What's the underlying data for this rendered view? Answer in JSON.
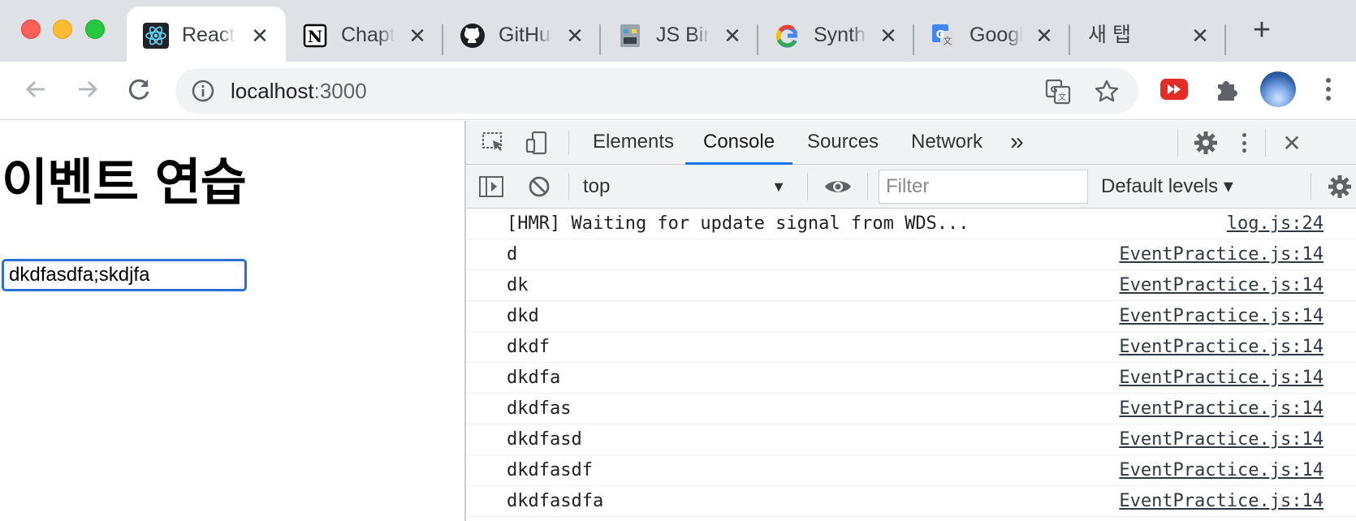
{
  "browser": {
    "tabs": [
      {
        "title": "React App",
        "icon": "react-icon",
        "active": true
      },
      {
        "title": "Chapter",
        "icon": "notion-icon"
      },
      {
        "title": "GitHub",
        "icon": "github-icon"
      },
      {
        "title": "JS Bin",
        "icon": "jsbin-icon"
      },
      {
        "title": "Synthetic",
        "icon": "google-icon"
      },
      {
        "title": "Google",
        "icon": "google-translate-icon"
      },
      {
        "title": "새 탭",
        "icon": null
      }
    ],
    "close_glyph": "✕",
    "new_tab_glyph": "+",
    "url_host": "localhost",
    "url_port": ":3000"
  },
  "page": {
    "heading": "이벤트 연습",
    "input_value": "dkdfasdfa;skdjfa"
  },
  "devtools": {
    "tabs": [
      "Elements",
      "Console",
      "Sources",
      "Network"
    ],
    "active_tab": "Console",
    "more_tabs_glyph": "»",
    "close_glyph": "✕",
    "context": "top",
    "caret": "▼",
    "filter_placeholder": "Filter",
    "levels": "Default levels ▾",
    "logs": [
      {
        "message": "[HMR] Waiting for update signal from WDS...",
        "source": "log.js:24"
      },
      {
        "message": "d",
        "source": "EventPractice.js:14"
      },
      {
        "message": "dk",
        "source": "EventPractice.js:14"
      },
      {
        "message": "dkd",
        "source": "EventPractice.js:14"
      },
      {
        "message": "dkdf",
        "source": "EventPractice.js:14"
      },
      {
        "message": "dkdfa",
        "source": "EventPractice.js:14"
      },
      {
        "message": "dkdfas",
        "source": "EventPractice.js:14"
      },
      {
        "message": "dkdfasd",
        "source": "EventPractice.js:14"
      },
      {
        "message": "dkdfasdf",
        "source": "EventPractice.js:14"
      },
      {
        "message": "dkdfasdfa",
        "source": "EventPractice.js:14"
      }
    ]
  },
  "colors": {
    "accent": "#1a73e8",
    "input_focus": "#2b6fd6"
  }
}
